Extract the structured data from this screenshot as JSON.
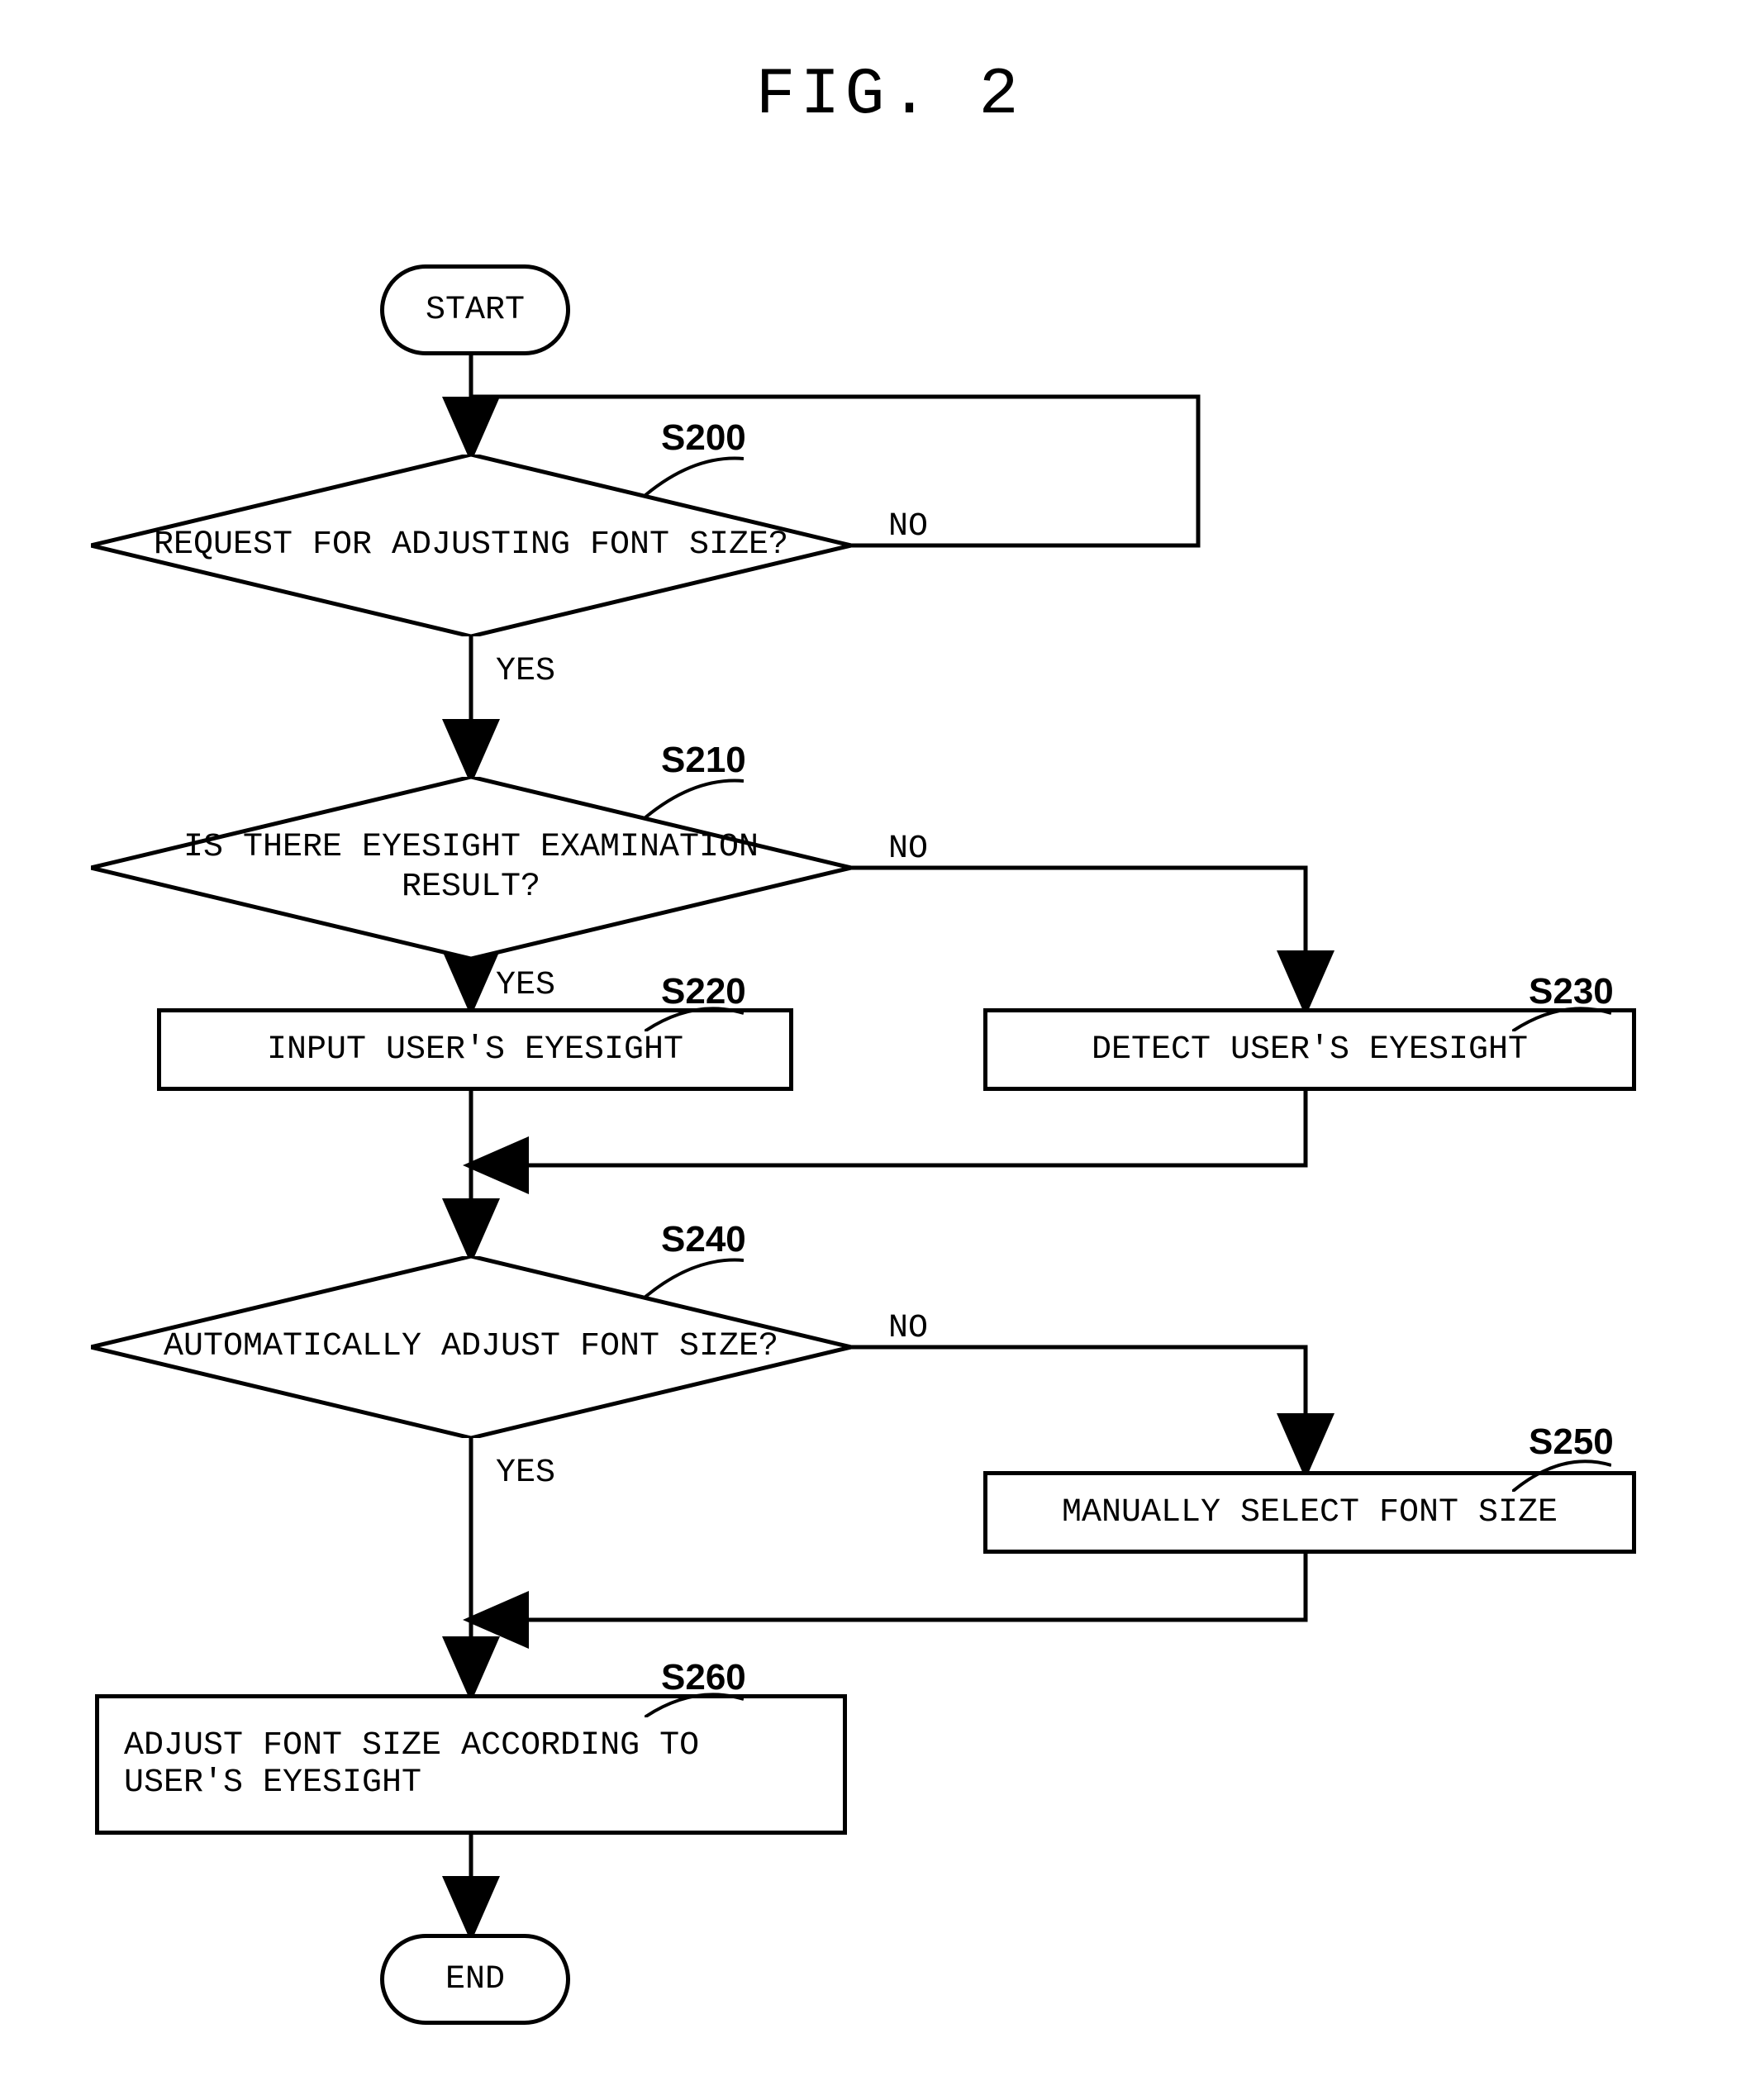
{
  "figure_title": "FIG. 2",
  "terminals": {
    "start": "START",
    "end": "END"
  },
  "decisions": {
    "s200": "REQUEST FOR ADJUSTING FONT SIZE?",
    "s210": "IS THERE EYESIGHT EXAMINATION RESULT?",
    "s240": "AUTOMATICALLY ADJUST FONT SIZE?"
  },
  "processes": {
    "s220": "INPUT USER'S EYESIGHT",
    "s230": "DETECT USER'S EYESIGHT",
    "s250": "MANUALLY SELECT FONT SIZE",
    "s260": "ADJUST FONT SIZE ACCORDING TO USER'S EYESIGHT"
  },
  "branch_labels": {
    "yes": "YES",
    "no": "NO"
  },
  "step_labels": {
    "s200": "S200",
    "s210": "S210",
    "s220": "S220",
    "s230": "S230",
    "s240": "S240",
    "s250": "S250",
    "s260": "S260"
  }
}
